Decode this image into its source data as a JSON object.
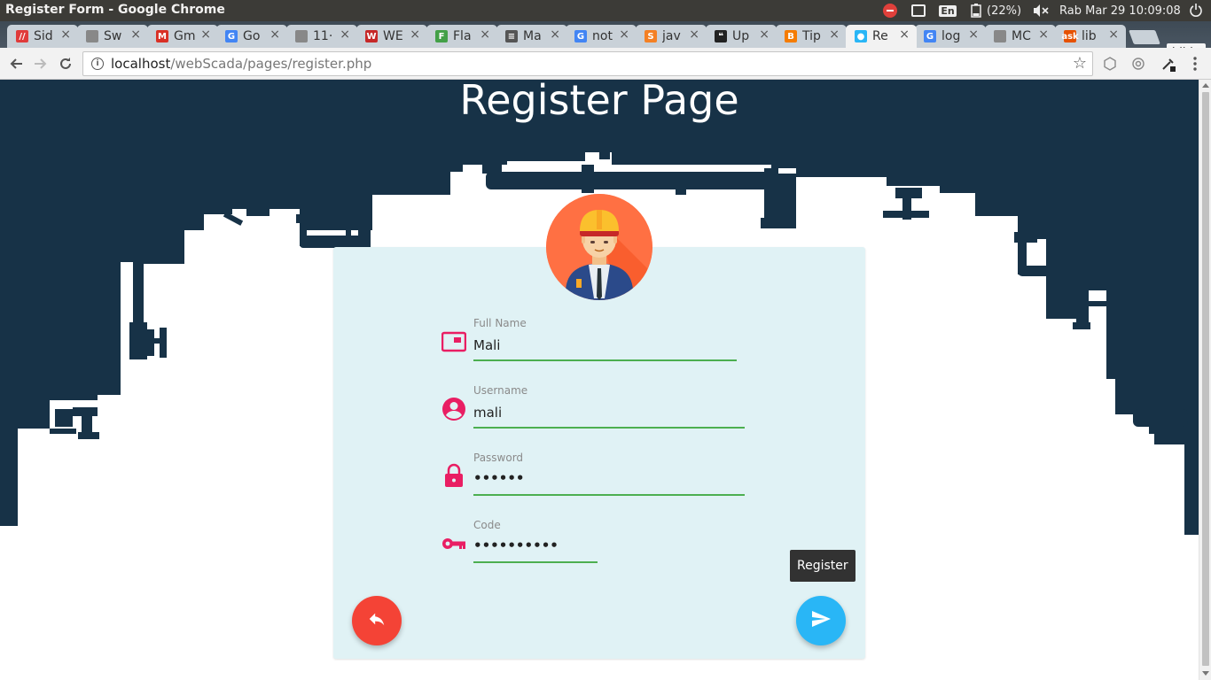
{
  "os": {
    "window_title": "Register Form - Google Chrome",
    "lang": "En",
    "battery": "(22%)",
    "clock": "Rab Mar 29 10:09:08"
  },
  "browser": {
    "tabs": [
      {
        "label": "Sid",
        "favicon_color": "#e03b3b",
        "favicon_text": "//"
      },
      {
        "label": "Sw",
        "favicon_color": "#888888",
        "favicon_text": ""
      },
      {
        "label": "Gm",
        "favicon_color": "#d93025",
        "favicon_text": "M"
      },
      {
        "label": "Go",
        "favicon_color": "#4285f4",
        "favicon_text": "G"
      },
      {
        "label": "11·",
        "favicon_color": "#888888",
        "favicon_text": ""
      },
      {
        "label": "WE",
        "favicon_color": "#c62828",
        "favicon_text": "W"
      },
      {
        "label": "Fla",
        "favicon_color": "#43a047",
        "favicon_text": "F"
      },
      {
        "label": "Ma",
        "favicon_color": "#555555",
        "favicon_text": "≡"
      },
      {
        "label": "not",
        "favicon_color": "#4285f4",
        "favicon_text": "G"
      },
      {
        "label": "jav",
        "favicon_color": "#f48024",
        "favicon_text": "S"
      },
      {
        "label": "Up",
        "favicon_color": "#222222",
        "favicon_text": "❝"
      },
      {
        "label": "Tip",
        "favicon_color": "#f57c00",
        "favicon_text": "B"
      },
      {
        "label": "Re",
        "favicon_color": "#29b6f6",
        "favicon_text": "●"
      },
      {
        "label": "log",
        "favicon_color": "#4285f4",
        "favicon_text": "G"
      },
      {
        "label": "MC",
        "favicon_color": "#888888",
        "favicon_text": ""
      },
      {
        "label": "lib",
        "favicon_color": "#e65100",
        "favicon_text": "ask"
      }
    ],
    "active_tab_index": 12,
    "profile_name": "hilda",
    "url_host": "localhost",
    "url_path": "/webScada/pages/register.php"
  },
  "page": {
    "title": "Register Page",
    "header_color": "#173247",
    "form": {
      "fields": [
        {
          "label": "Full Name",
          "value": "Mali",
          "type": "text",
          "icon": "id-card-icon"
        },
        {
          "label": "Username",
          "value": "mali",
          "type": "text",
          "icon": "account-circle-icon"
        },
        {
          "label": "Password",
          "value": "••••••",
          "type": "password",
          "icon": "lock-icon"
        },
        {
          "label": "Code",
          "value": "••••••••••",
          "type": "password",
          "icon": "key-icon"
        }
      ],
      "register_tooltip": "Register",
      "back_icon": "reply-icon",
      "submit_icon": "send-icon"
    },
    "colors": {
      "card": "#e0f2f5",
      "accent_pink": "#e91e63",
      "underline_green": "#4caf50",
      "back_red": "#f44336",
      "submit_blue": "#29b6f6"
    }
  }
}
